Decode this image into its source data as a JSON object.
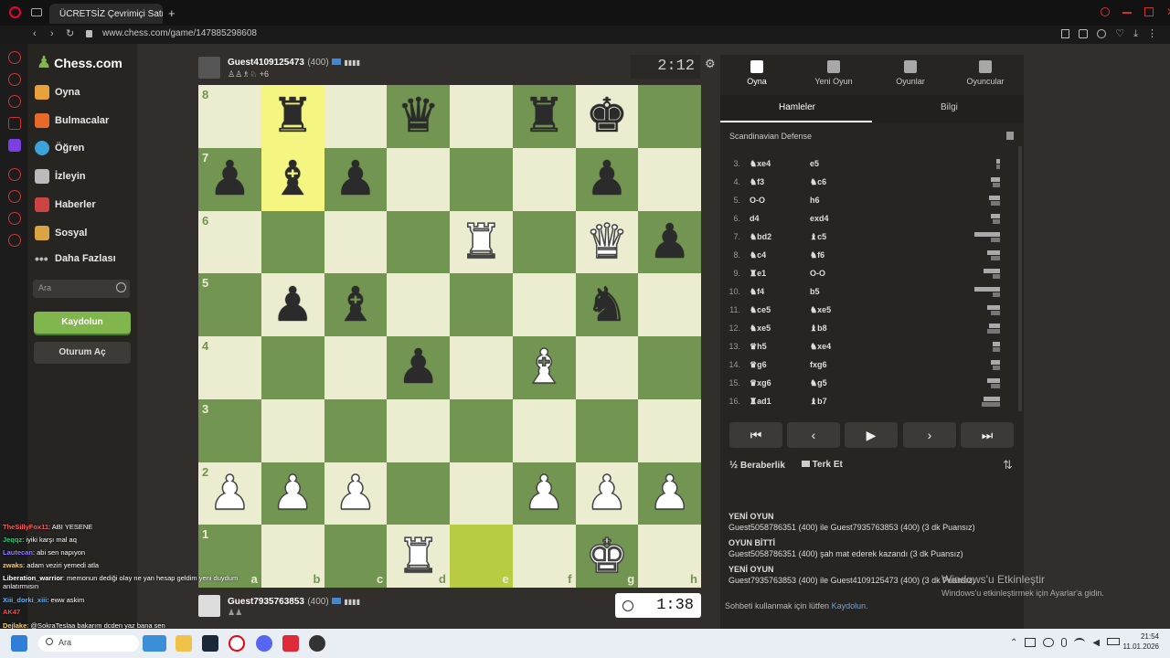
{
  "browser": {
    "tab_title": "ÜCRETSİZ Çevrimiçi Satra...",
    "url": "www.chess.com/game/147885298608",
    "new_tab": "+"
  },
  "nav": {
    "logo": "Chess.com",
    "items": [
      "Oyna",
      "Bulmacalar",
      "Öğren",
      "İzleyin",
      "Haberler",
      "Sosyal",
      "Daha Fazlası"
    ],
    "search_placeholder": "Ara",
    "signup": "Kaydolun",
    "login": "Oturum Aç"
  },
  "top_player": {
    "name": "Guest4109125473",
    "rating": "(400)",
    "extra": "+6",
    "clock": "2:12"
  },
  "bottom_player": {
    "name": "Guest7935763853",
    "rating": "(400)",
    "clock": "1:38"
  },
  "board": {
    "ranks": [
      "8",
      "7",
      "6",
      "5",
      "4",
      "3",
      "2",
      "1"
    ],
    "files": [
      "a",
      "b",
      "c",
      "d",
      "e",
      "f",
      "g",
      "h"
    ],
    "highlights": {
      "b8": "yellow",
      "b7": "yellow",
      "e1": "green"
    },
    "position": [
      [
        "",
        "bR",
        "",
        "bQ",
        "",
        "bR",
        "bK",
        ""
      ],
      [
        "bP",
        "bB",
        "bP",
        "",
        "",
        "",
        "bP",
        ""
      ],
      [
        "",
        "",
        "",
        "",
        "wR",
        "",
        "wQ",
        "bP"
      ],
      [
        "",
        "bP",
        "bB",
        "",
        "",
        "",
        "bN",
        ""
      ],
      [
        "",
        "",
        "",
        "bP",
        "",
        "wB",
        "",
        ""
      ],
      [
        "",
        "",
        "",
        "",
        "",
        "",
        "",
        ""
      ],
      [
        "wP",
        "wP",
        "wP",
        "",
        "",
        "wP",
        "wP",
        "wP"
      ],
      [
        "",
        "",
        "",
        "wR",
        "",
        "",
        "wK",
        ""
      ]
    ]
  },
  "right_tabs": [
    "Oyna",
    "Yeni Oyun",
    "Oyunlar",
    "Oyuncular"
  ],
  "sub_tabs": [
    "Hamleler",
    "Bilgi"
  ],
  "opening": "Scandinavian Defense",
  "moves": [
    {
      "n": "3.",
      "w": "♞xe4",
      "b": "e5"
    },
    {
      "n": "4.",
      "w": "♞f3",
      "b": "♞c6"
    },
    {
      "n": "5.",
      "w": "O-O",
      "b": "h6"
    },
    {
      "n": "6.",
      "w": "d4",
      "b": "exd4"
    },
    {
      "n": "7.",
      "w": "♞bd2",
      "b": "♝c5"
    },
    {
      "n": "8.",
      "w": "♞c4",
      "b": "♞f6"
    },
    {
      "n": "9.",
      "w": "♜e1",
      "b": "O-O"
    },
    {
      "n": "10.",
      "w": "♞f4",
      "b": "b5"
    },
    {
      "n": "11.",
      "w": "♞ce5",
      "b": "♞xe5"
    },
    {
      "n": "12.",
      "w": "♞xe5",
      "b": "♝b8"
    },
    {
      "n": "13.",
      "w": "♛h5",
      "b": "♞xe4"
    },
    {
      "n": "14.",
      "w": "♛g6",
      "b": "fxg6"
    },
    {
      "n": "15.",
      "w": "♛xg6",
      "b": "♞g5"
    },
    {
      "n": "16.",
      "w": "♜ad1",
      "b": "♝b7"
    }
  ],
  "controls": [
    "⏮",
    "‹",
    "▶",
    "›",
    "⏭"
  ],
  "actions": {
    "draw_icon": "½",
    "draw": "Beraberlik",
    "resign": "Terk Et"
  },
  "log": [
    {
      "title": "YENİ OYUN",
      "text": "Guest5058786351 (400) ile Guest7935763853 (400) (3 dk Puansız)"
    },
    {
      "title": "OYUN BİTTİ",
      "text": "Guest5058786351 (400) şah mat ederek kazandı (3 dk Puansız)"
    },
    {
      "title": "YENİ OYUN",
      "text": "Guest7935763853 (400) ile Guest4109125473 (400) (3 dk Puansız)"
    }
  ],
  "chat_note": {
    "text": "Sohbeti kullanmak için lütfen ",
    "link": "Kaydolun."
  },
  "windows_activate": {
    "title": "Windows'u Etkinleştir",
    "sub": "Windows'u etkinleştirmek için Ayarlar'a gidin."
  },
  "taskbar": {
    "search": "Ara",
    "time": "21:54",
    "date": "11.01.2026"
  },
  "stream_chat": [
    {
      "user": "TheSillyFox11",
      "msg": ": ABI YESENE",
      "color": "#ff5a5a"
    },
    {
      "user": "Jeqqz",
      "msg": ": iyiki karşı mal aq",
      "color": "#2ecc71"
    },
    {
      "user": "Lautecan",
      "msg": ": abi sen napıyon",
      "color": "#8f7dff"
    },
    {
      "user": "zwaks",
      "msg": ": adam veziri yemedi atla",
      "color": "#ffd34d"
    },
    {
      "user": "Liberation_warrior",
      "msg": ": memonun dediği olay ne yan hesap geldim yeni duydum anlatırmısın",
      "color": "#ffffff"
    },
    {
      "user": "Xiii_dorki_xiii",
      "msg": ": eww askim",
      "color": "#5db7ff"
    },
    {
      "user": "AK47",
      "msg": "",
      "color": "#ff4d4d"
    },
    {
      "user": "Dejlake",
      "msg": ": @SokraTeslaa bakarım dcden yaz bana sen",
      "color": "#ffd34d"
    }
  ]
}
